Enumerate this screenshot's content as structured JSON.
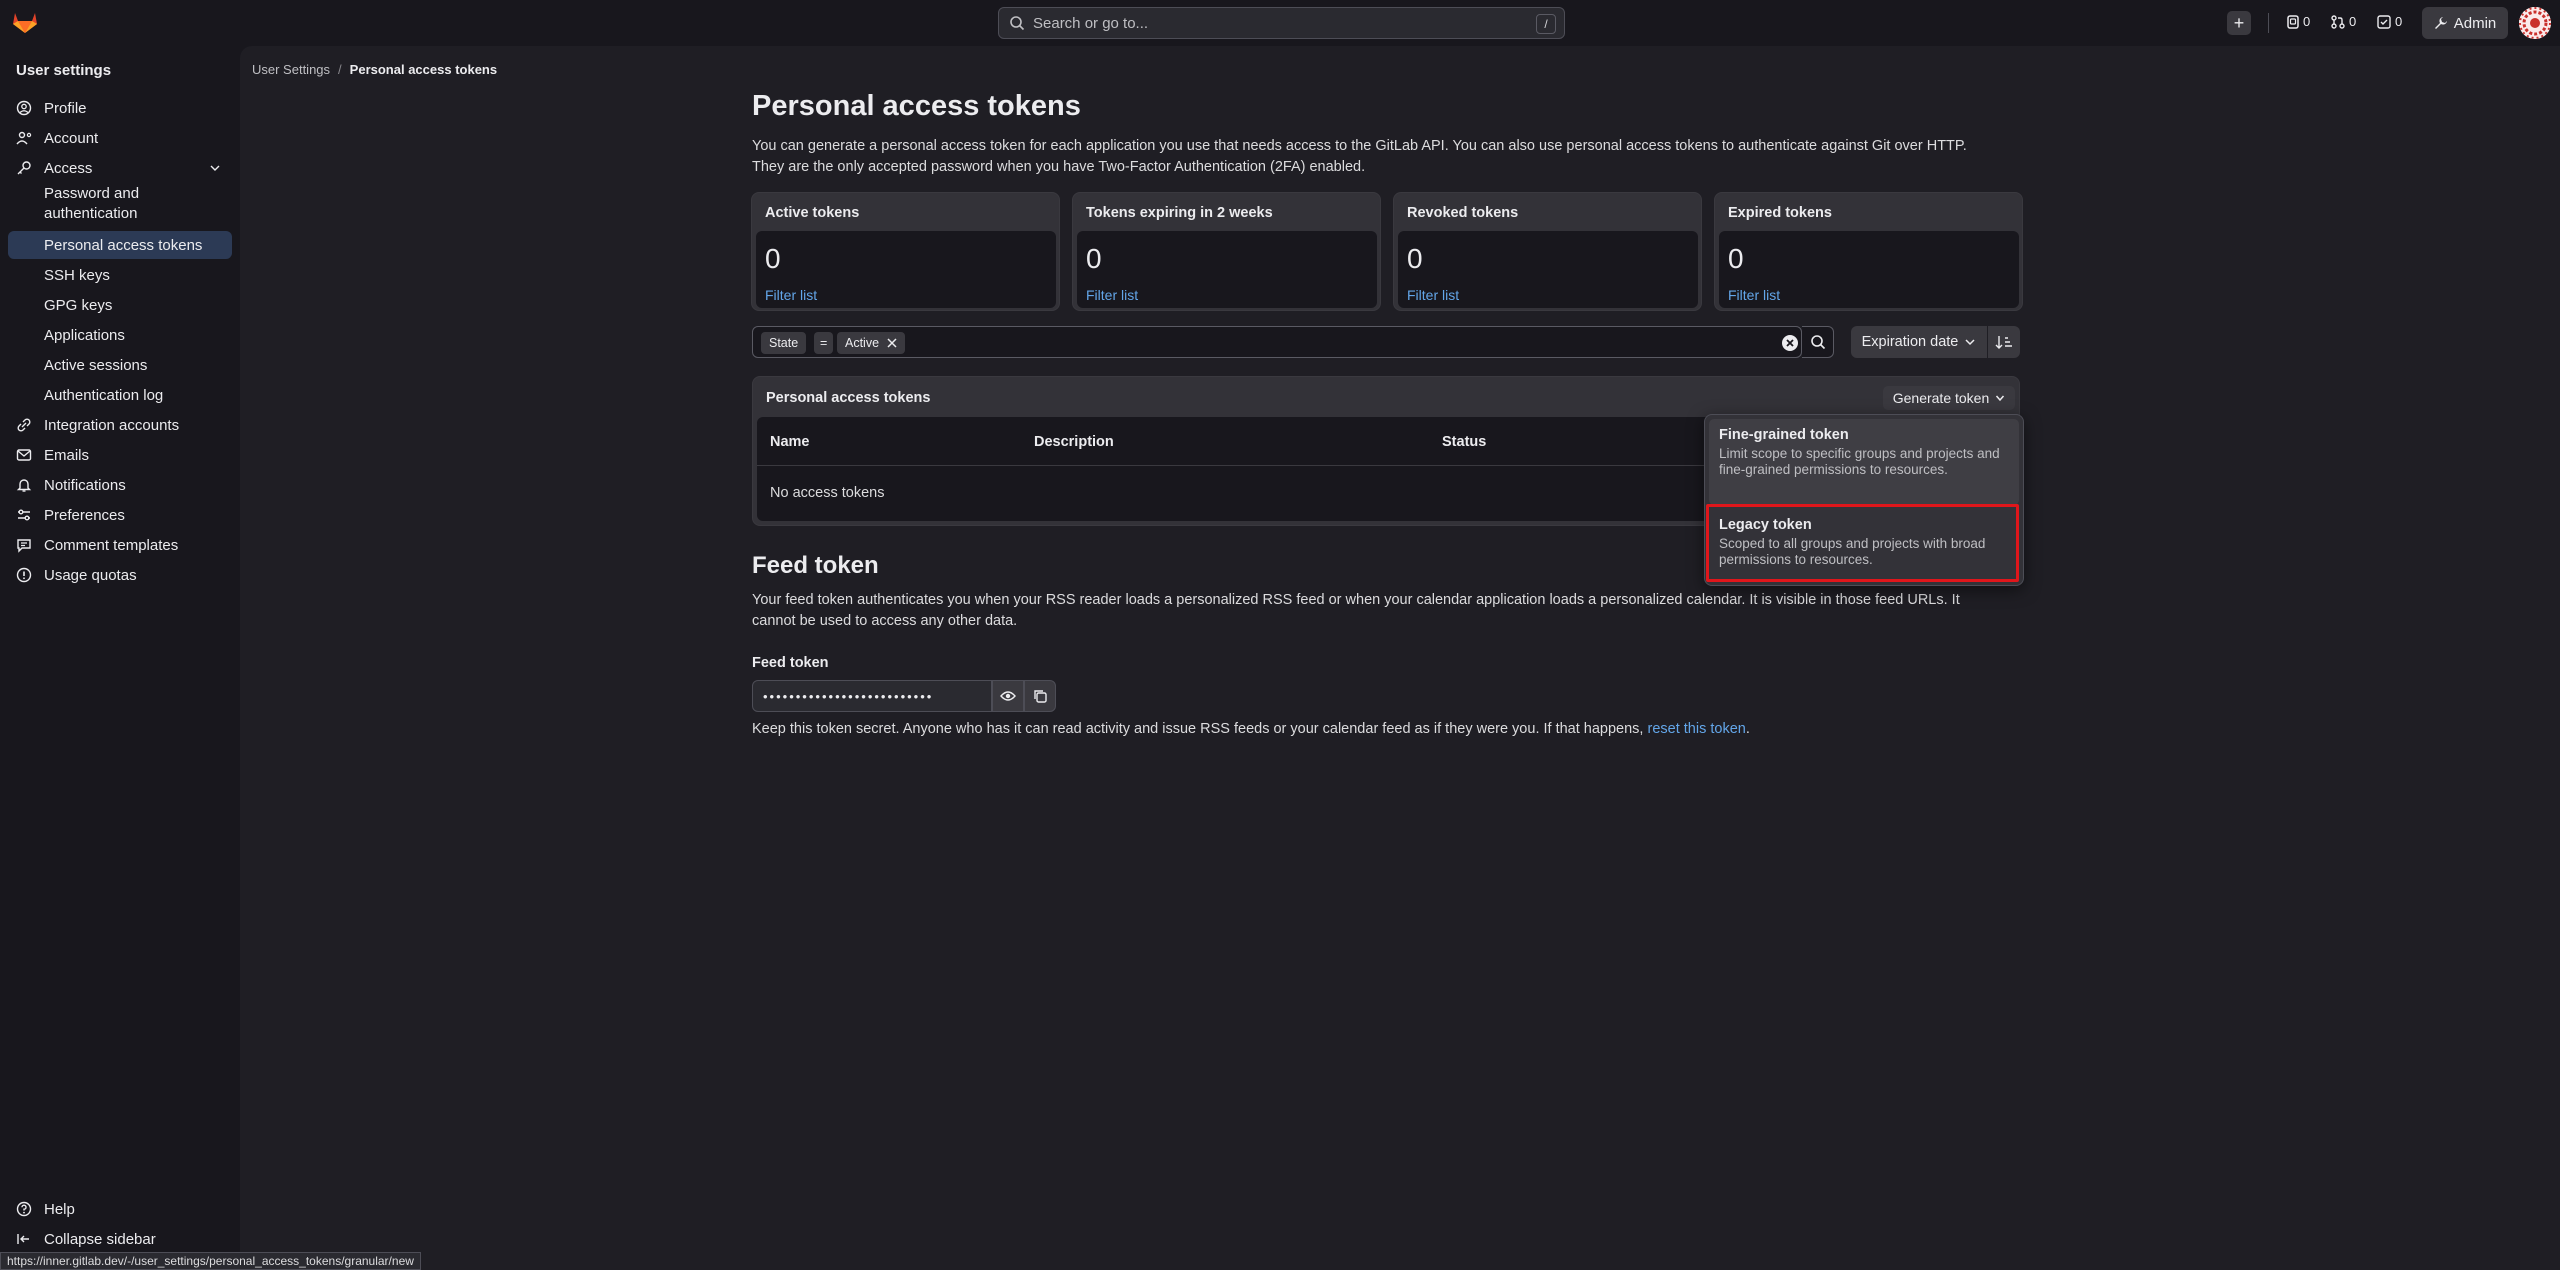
{
  "search": {
    "placeholder": "Search or go to...",
    "shortcut": "/"
  },
  "topbar": {
    "issues_count": "0",
    "mr_count": "0",
    "todo_count": "0",
    "admin_label": "Admin"
  },
  "sidebar": {
    "title": "User settings",
    "items": [
      {
        "label": "Profile",
        "icon": "profile-icon"
      },
      {
        "label": "Account",
        "icon": "account-icon"
      },
      {
        "label": "Access",
        "icon": "key-icon"
      },
      {
        "label": "Password and authentication"
      },
      {
        "label": "Personal access tokens"
      },
      {
        "label": "SSH keys"
      },
      {
        "label": "GPG keys"
      },
      {
        "label": "Applications"
      },
      {
        "label": "Active sessions"
      },
      {
        "label": "Authentication log"
      },
      {
        "label": "Integration accounts",
        "icon": "integration-icon"
      },
      {
        "label": "Emails",
        "icon": "email-icon"
      },
      {
        "label": "Notifications",
        "icon": "bell-icon"
      },
      {
        "label": "Preferences",
        "icon": "preferences-icon"
      },
      {
        "label": "Comment templates",
        "icon": "comment-icon"
      },
      {
        "label": "Usage quotas",
        "icon": "quota-icon"
      }
    ],
    "help": "Help",
    "collapse": "Collapse sidebar"
  },
  "breadcrumb": {
    "root": "User Settings",
    "current": "Personal access tokens"
  },
  "page": {
    "title": "Personal access tokens",
    "intro_line1": "You can generate a personal access token for each application you use that needs access to the GitLab API. You can also use personal access tokens to authenticate against Git over HTTP.",
    "intro_line2": "They are the only accepted password when you have Two-Factor Authentication (2FA) enabled."
  },
  "stats": [
    {
      "title": "Active tokens",
      "value": "0",
      "link": "Filter list"
    },
    {
      "title": "Tokens expiring in 2 weeks",
      "value": "0",
      "link": "Filter list"
    },
    {
      "title": "Revoked tokens",
      "value": "0",
      "link": "Filter list"
    },
    {
      "title": "Expired tokens",
      "value": "0",
      "link": "Filter list"
    }
  ],
  "filter": {
    "field": "State",
    "op": "=",
    "value": "Active"
  },
  "sort": {
    "label": "Expiration date"
  },
  "table": {
    "title": "Personal access tokens",
    "generate_label": "Generate token",
    "columns": [
      "Name",
      "Description",
      "Status"
    ],
    "empty": "No access tokens"
  },
  "dropdown": {
    "items": [
      {
        "title": "Fine-grained token",
        "desc": "Limit scope to specific groups and projects and fine-grained permissions to resources."
      },
      {
        "title": "Legacy token",
        "desc": "Scoped to all groups and projects with broad permissions to resources."
      }
    ]
  },
  "feed": {
    "title": "Feed token",
    "desc_line1": "Your feed token authenticates you when your RSS reader loads a personalized RSS feed or when your calendar application loads a personalized calendar. It is visible in those feed URLs. It",
    "desc_line2": "cannot be used to access any other data.",
    "label": "Feed token",
    "masked": "••••••••••••••••••••••••••",
    "help_prefix": "Keep this token secret. Anyone who has it can read activity and issue RSS feeds or your calendar feed as if they were you. If that happens, ",
    "help_link": "reset this token",
    "help_suffix": "."
  },
  "status_url": "https://inner.gitlab.dev/-/user_settings/personal_access_tokens/granular/new",
  "colors": {
    "accent": "#63a6e9",
    "highlight": "#e0161b",
    "active_nav": "#2c3a55"
  }
}
